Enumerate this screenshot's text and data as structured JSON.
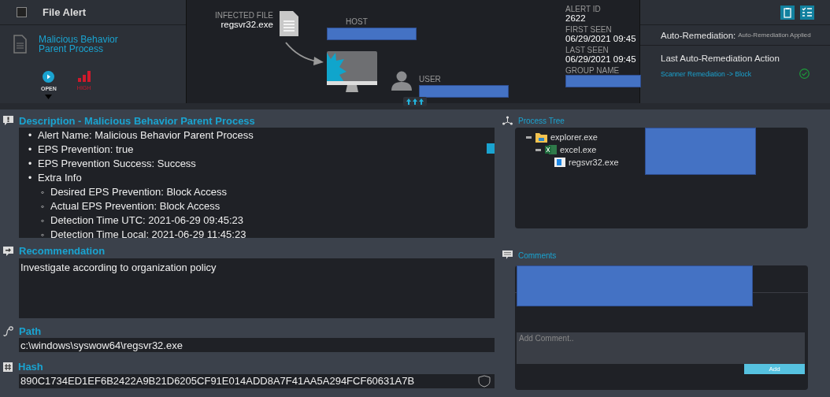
{
  "header": {
    "checked": false,
    "title": "File Alert",
    "alert_name": "Malicious Behavior Parent Process",
    "status": "OPEN",
    "severity": "HIGH"
  },
  "infection": {
    "infected_file_label": "INFECTED FILE",
    "infected_file": "regsvr32.exe",
    "host_label": "HOST",
    "user_label": "USER"
  },
  "alert_info": [
    {
      "label": "ALERT ID",
      "value": "2622"
    },
    {
      "label": "FIRST SEEN",
      "value": "06/29/2021 09:45"
    },
    {
      "label": "LAST SEEN",
      "value": "06/29/2021 09:45"
    },
    {
      "label": "GROUP NAME"
    }
  ],
  "remediation": {
    "label": "Auto-Remediation:",
    "status": "Auto-Remediation Applied",
    "last_action_title": "Last Auto-Remediation Action",
    "last_action": "Scanner Remediation -> Block"
  },
  "description": {
    "title": "Description - Malicious Behavior Parent Process",
    "items": [
      {
        "marker": "•",
        "text": "Alert Name: Malicious Behavior Parent Process"
      },
      {
        "marker": "•",
        "text": "EPS Prevention: true"
      },
      {
        "marker": "•",
        "text": "EPS Prevention Success: Success"
      },
      {
        "marker": "•",
        "text": "Extra Info",
        "children": [
          {
            "marker": "◦",
            "text": "Desired EPS Prevention: Block Access"
          },
          {
            "marker": "◦",
            "text": "Actual EPS Prevention: Block Access"
          },
          {
            "marker": "◦",
            "text": "Detection Time UTC: 2021-06-29 09:45:23"
          },
          {
            "marker": "◦",
            "text": "Detection Time Local: 2021-06-29 11:45:23"
          }
        ]
      }
    ]
  },
  "recommendation": {
    "title": "Recommendation",
    "text": "Investigate according to organization policy"
  },
  "path": {
    "title": "Path",
    "value": "c:\\windows\\syswow64\\regsvr32.exe"
  },
  "hash": {
    "title": "Hash",
    "value": "890C1734ED1EF6B2422A9B21D6205CF91E014ADD8A7F41AA5A294FCF60631A7B"
  },
  "process_tree": {
    "title": "Process Tree",
    "nodes": [
      {
        "name": "explorer.exe",
        "kind": "folder",
        "expanded": true,
        "children": [
          {
            "name": "excel.exe",
            "kind": "excel",
            "expanded": true,
            "children": [
              {
                "name": "regsvr32.exe",
                "kind": "app"
              }
            ]
          }
        ]
      }
    ]
  },
  "comments": {
    "title": "Comments",
    "placeholder": "Add Comment..",
    "button": "Add"
  }
}
